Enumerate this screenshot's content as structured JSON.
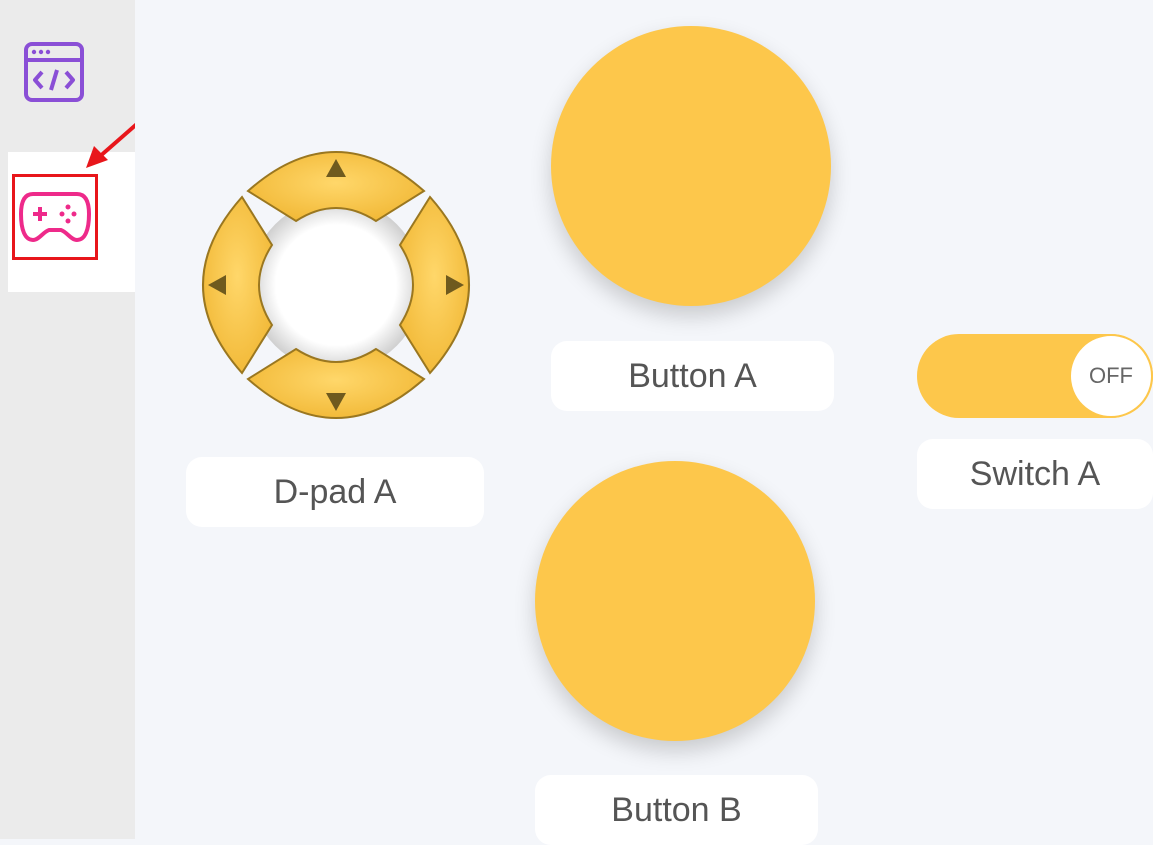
{
  "sidebar": {
    "items": [
      {
        "icon": "code-window-icon",
        "color": "#8a4fd6"
      },
      {
        "icon": "gamepad-icon",
        "color": "#ee2a8a",
        "selected": true
      }
    ],
    "highlight_color": "#e8161b"
  },
  "controls": {
    "dpad": {
      "label": "D-pad A",
      "icon": "dpad-icon"
    },
    "button_a": {
      "label": "Button A"
    },
    "button_b": {
      "label": "Button B"
    },
    "switch_a": {
      "label": "Switch A",
      "state": "OFF"
    }
  },
  "colors": {
    "accent": "#fdc74b",
    "background": "#f4f6fa",
    "sidebar": "#ebebeb",
    "label_text": "#555555"
  }
}
